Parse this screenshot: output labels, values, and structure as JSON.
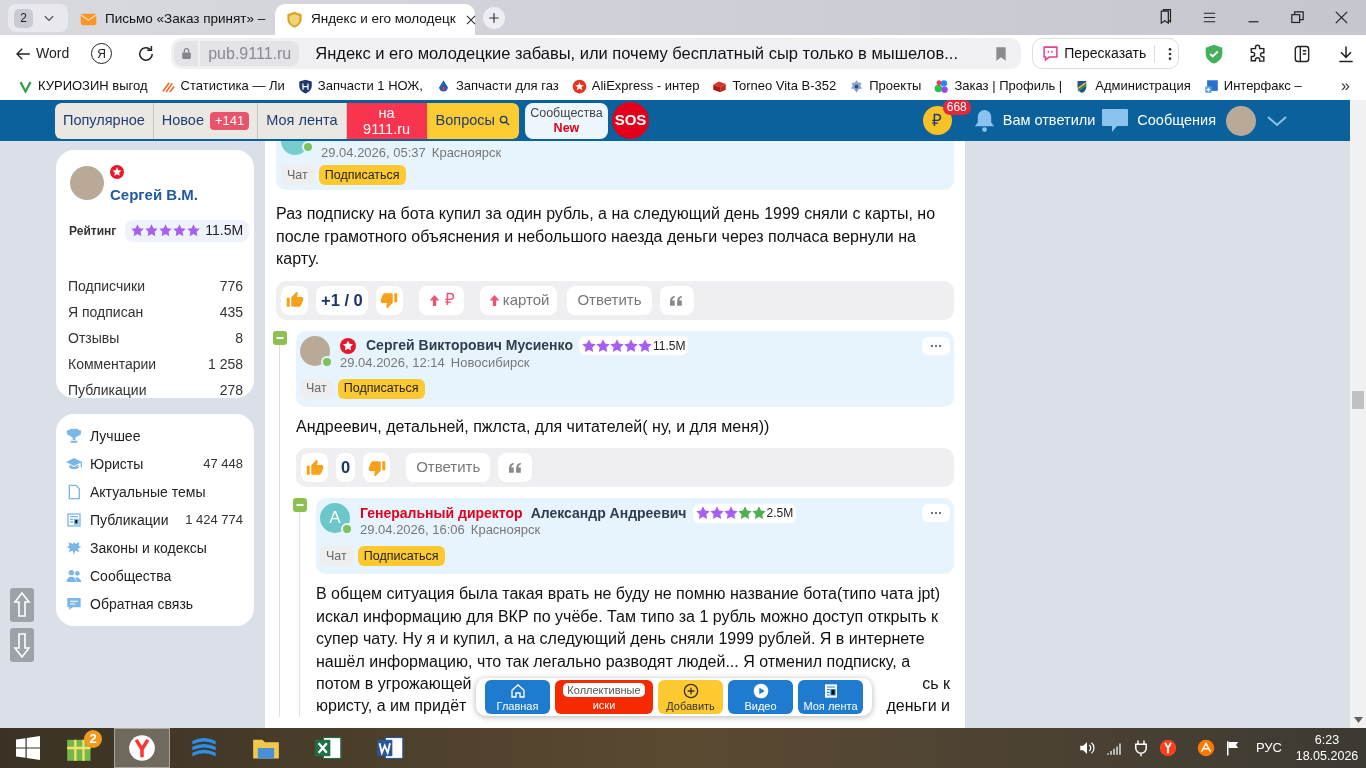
{
  "browser": {
    "tab_count": "2",
    "tabs": [
      {
        "title": "Письмо «Заказ принят» –",
        "selected": false
      },
      {
        "title": "Яндекс и его молодецк",
        "selected": true
      }
    ],
    "back_label": "Word",
    "home_logo": "Я",
    "domain": "pub.9111.ru",
    "page_title": "Яндекс и его молодецкие забавы, или почему бесплатный сыр только в мышелов...",
    "retell_label": "Пересказать",
    "bookmarks": [
      "КУРИОЗИН выгод",
      "Статистика — Ли",
      "Запчасти 1 НОЖ,",
      "Запчасти для газ",
      "AliExpress - интер",
      "Torneo Vita B-352",
      "Проекты",
      "Заказ | Профиль |",
      "Администрация",
      "Интерфакс –"
    ],
    "more_bookmarks": "»"
  },
  "site_nav": {
    "tabs": [
      {
        "label": "Популярное",
        "kind": "plain"
      },
      {
        "label": "Новое",
        "badge": "+141",
        "kind": "plain"
      },
      {
        "label": "Моя лента",
        "kind": "plain"
      },
      {
        "label": "на 9111.ru",
        "kind": "promo"
      },
      {
        "label": "Вопросы",
        "kind": "search"
      }
    ],
    "communities": {
      "label": "Сообщества",
      "badge": "New"
    },
    "sos": "SOS",
    "coins": {
      "symbol": "₽",
      "badge": "668"
    },
    "replies": "Вам ответили",
    "messages": "Сообщения"
  },
  "profile": {
    "name": "Сергей В.М.",
    "star_badge": true,
    "rating_label": "Рейтинг",
    "stars": 5,
    "rating": "11.5M",
    "stats": [
      {
        "label": "Подписчики",
        "value": "776"
      },
      {
        "label": "Я подписан",
        "value": "435"
      },
      {
        "label": "Отзывы",
        "value": "8"
      },
      {
        "label": "Комментарии",
        "value": "1 258"
      },
      {
        "label": "Публикации",
        "value": "278"
      }
    ]
  },
  "menu": [
    {
      "label": "Лучшее"
    },
    {
      "label": "Юристы",
      "count": "47 448"
    },
    {
      "label": "Актуальные темы"
    },
    {
      "label": "Публикации",
      "count": "1 424 774"
    },
    {
      "label": "Законы и кодексы"
    },
    {
      "label": "Сообщества"
    },
    {
      "label": "Обратная связь"
    }
  ],
  "comments": [
    {
      "online": true,
      "date": "29.04.2026, 05:37",
      "city": "Красноярск",
      "chat": "Чат",
      "subscribe": "Подписаться",
      "text": "Раз подписку на бота купил за один рубль, а на следующий день 1999 сняли с карты, но после грамотного объяснения и небольшого наезда деньги через полчаса вернули на карту.",
      "actions": {
        "votes": "+1 / 0",
        "donate": "₽",
        "card": "картой",
        "reply": "Ответить"
      },
      "replies": [
        {
          "expanded": true,
          "star_badge": true,
          "author": "Сергей Викторович Мусиенко",
          "rating": {
            "stars": 5,
            "value": "11.5M"
          },
          "online": true,
          "date": "29.04.2026, 12:14",
          "city": "Новосибирск",
          "chat": "Чат",
          "subscribe": "Подписаться",
          "text": "Андреевич, детальней, пжлста, для читателей( ну, и для меня))",
          "actions": {
            "votes": "0",
            "reply": "Ответить"
          },
          "replies": [
            {
              "expanded": true,
              "star_badge": false,
              "role": "Генеральный директор",
              "author": "Александр Андреевич",
              "avatar_letter": "А",
              "rating": {
                "stars": 3,
                "value": "2.5M"
              },
              "online": true,
              "date": "29.04.2026, 16:06",
              "city": "Красноярск",
              "chat": "Чат",
              "subscribe": "Подписаться",
              "text": "В общем ситуация была такая врать не буду не помню название бота(типо чата jpt) искал информацию для ВКР по учёбе. Там типо за 1 рубль можно доступ открыть к супер чату. Ну я и купил, а на следующий день сняли 1999 рублей. Я в интернете нашёл информацию, что так легально разводят людей... Я отменил подписку, а",
              "covered_lines": [
                {
                  "left": "потом в угрожающей",
                  "right": "сь к"
                },
                {
                  "left": "юристу, а им придёт",
                  "right": "деньги и"
                }
              ]
            }
          ]
        }
      ]
    }
  ],
  "bottom_bar": [
    {
      "label": "Главная",
      "kind": "blue"
    },
    {
      "label": "Коллективные",
      "sub": "иски",
      "kind": "red"
    },
    {
      "label": "Добавить",
      "kind": "yellow"
    },
    {
      "label": "Видео",
      "kind": "blue"
    },
    {
      "label": "Моя лента",
      "kind": "blue"
    }
  ],
  "taskbar": {
    "apps": [
      {
        "selected": false,
        "badge": "2"
      },
      {
        "selected": true
      },
      {
        "selected": false
      },
      {
        "selected": false
      },
      {
        "selected": false
      },
      {
        "selected": false
      }
    ],
    "language": "РУС",
    "time": "6:23",
    "date": "18.05.2026"
  }
}
